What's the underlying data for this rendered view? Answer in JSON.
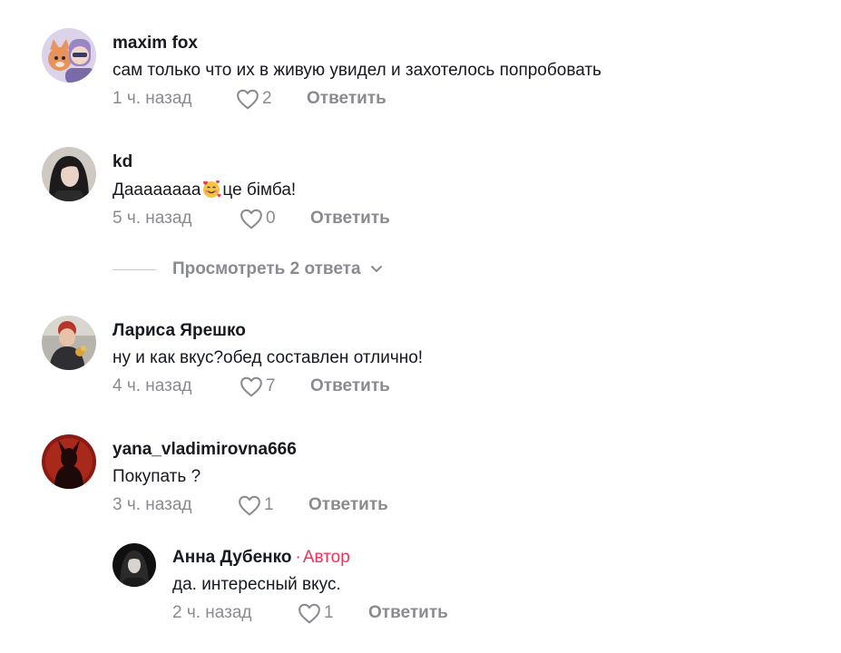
{
  "comments": [
    {
      "username": "maxim fox",
      "text": "сам только что их в живую увидел и захотелось попробовать",
      "time": "1 ч. назад",
      "likes": "2",
      "reply_label": "Ответить",
      "avatar_icon": "cartoon-avatar-icon"
    },
    {
      "username": "kd",
      "text_before": "Даааааааа",
      "text_after": "це бімба!",
      "emoji_icon": "smiling-face-with-hearts-icon",
      "time": "5 ч. назад",
      "likes": "0",
      "reply_label": "Ответить",
      "avatar_icon": "photo-avatar-icon"
    },
    {
      "username": "Лариса Ярешко",
      "text": "ну и как вкус?обед составлен отлично!",
      "time": "4 ч. назад",
      "likes": "7",
      "reply_label": "Ответить",
      "avatar_icon": "photo-avatar-icon"
    },
    {
      "username": "yana_vladimirovna666",
      "text": "Покупать ?",
      "time": "3 ч. назад",
      "likes": "1",
      "reply_label": "Ответить",
      "avatar_icon": "devil-silhouette-avatar-icon"
    }
  ],
  "view_replies": {
    "label": "Просмотреть 2 ответа",
    "icon": "chevron-down-icon"
  },
  "reply": {
    "username": "Анна Дубенко",
    "separator": "·",
    "badge": "Автор",
    "text": "да. интересный вкус.",
    "time": "2 ч. назад",
    "likes": "1",
    "reply_label": "Ответить",
    "avatar_icon": "photo-avatar-icon"
  },
  "colors": {
    "text": "#161823",
    "muted": "#8a8b91",
    "author_badge": "#fe2c55"
  }
}
